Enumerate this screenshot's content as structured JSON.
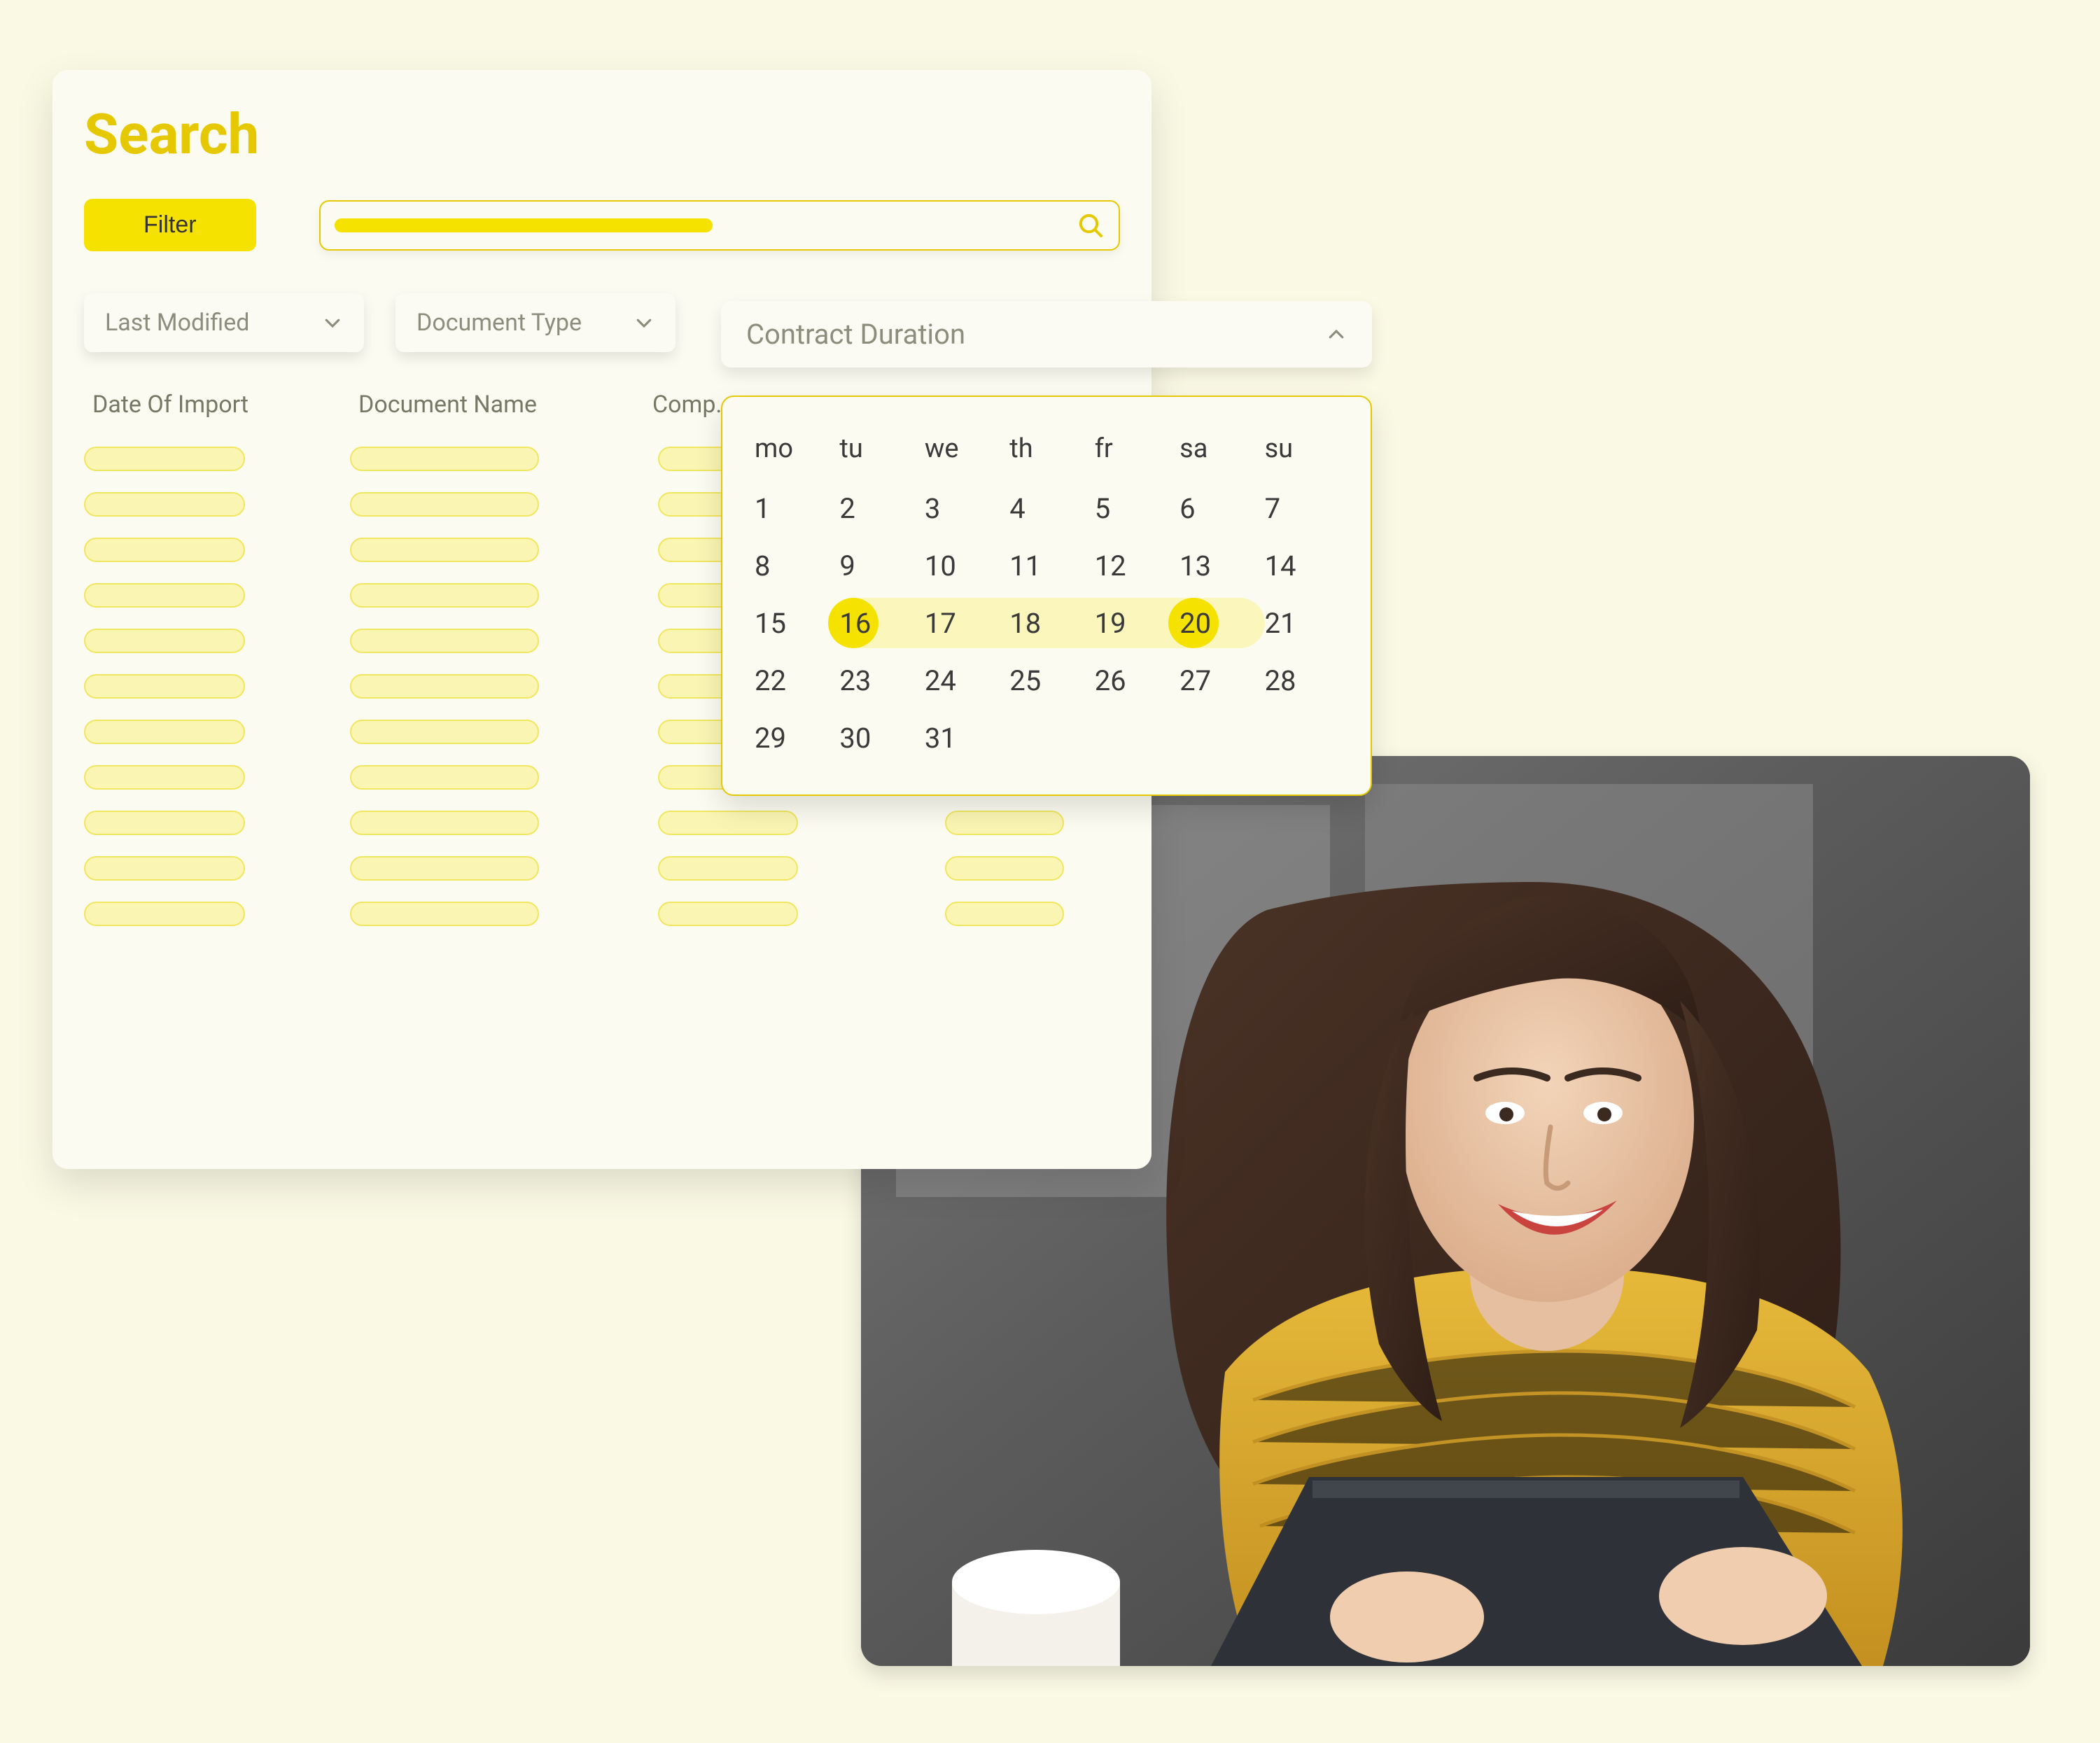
{
  "colors": {
    "accent": "#e6c800",
    "accent_fill": "#f6e200",
    "bg": "#faf9e4",
    "panel": "#fbfbf1",
    "text_muted": "#8d8d7d"
  },
  "search": {
    "title": "Search",
    "filter_label": "Filter",
    "search_placeholder": ""
  },
  "dropdowns": {
    "last_modified": "Last Modified",
    "document_type": "Document Type",
    "contract_duration": "Contract Duration"
  },
  "table": {
    "headers": [
      "Date Of Import",
      "Document Name",
      "Comp…"
    ],
    "row_count": 11
  },
  "calendar": {
    "weekdays": [
      "mo",
      "tu",
      "we",
      "th",
      "fr",
      "sa",
      "su"
    ],
    "weeks": [
      [
        1,
        2,
        3,
        4,
        5,
        6,
        7
      ],
      [
        8,
        9,
        10,
        11,
        12,
        13,
        14
      ],
      [
        15,
        16,
        17,
        18,
        19,
        20,
        21
      ],
      [
        22,
        23,
        24,
        25,
        26,
        27,
        28
      ],
      [
        29,
        30,
        31,
        null,
        null,
        null,
        null
      ]
    ],
    "selected_range": {
      "start": 16,
      "end": 20
    }
  }
}
